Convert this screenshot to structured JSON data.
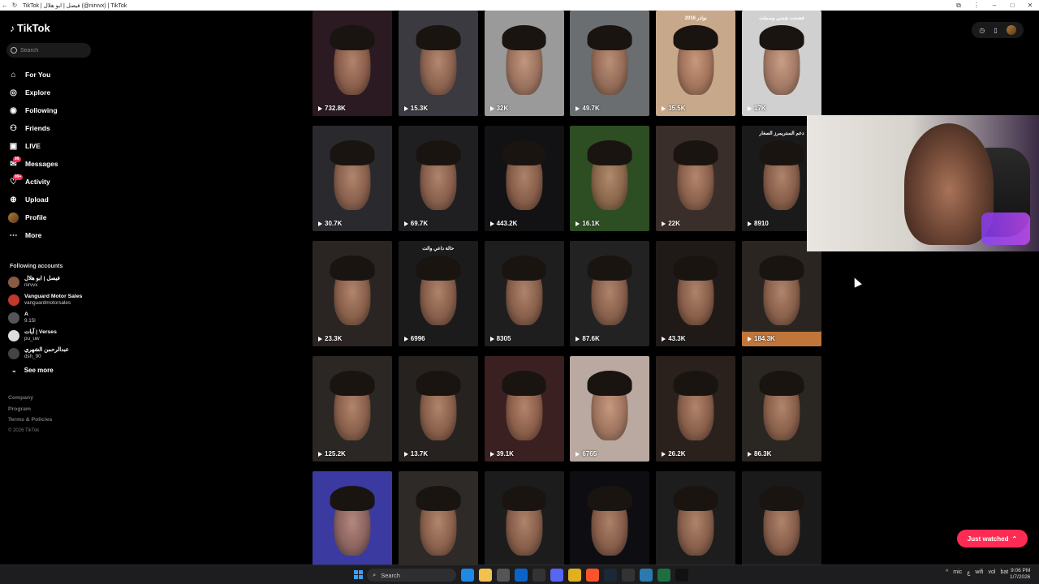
{
  "browser": {
    "title": "TikTok | فيصل | ابو هلال (@nirvvx) | TikTok",
    "back_icon": "back-arrow-icon",
    "reload_icon": "reload-icon",
    "controls": [
      "minimize",
      "maximize",
      "close"
    ]
  },
  "sidebar": {
    "logo": "TikTok",
    "search_placeholder": "Search",
    "menu": [
      {
        "label": "For You",
        "icon": "home-icon"
      },
      {
        "label": "Explore",
        "icon": "compass-icon"
      },
      {
        "label": "Following",
        "icon": "following-icon"
      },
      {
        "label": "Friends",
        "icon": "friends-icon"
      },
      {
        "label": "LIVE",
        "icon": "live-icon"
      },
      {
        "label": "Messages",
        "icon": "messages-icon",
        "badge": "99"
      },
      {
        "label": "Activity",
        "icon": "activity-icon",
        "badge": "99+"
      },
      {
        "label": "Upload",
        "icon": "upload-icon"
      },
      {
        "label": "Profile",
        "icon": "profile-avatar"
      },
      {
        "label": "More",
        "icon": "more-icon"
      }
    ],
    "following_label": "Following accounts",
    "accounts": [
      {
        "name": "فيصل | ابو هلال",
        "handle": "nirvvx",
        "color": "#8a5a44"
      },
      {
        "name": "Vanguard Motor Sales",
        "handle": "vanguardmotorsales",
        "color": "#c0392b"
      },
      {
        "name": "A",
        "handle": "9.15l",
        "color": "#555555"
      },
      {
        "name": "آيات | Verses",
        "handle": "pu_uw",
        "color": "#dddddd"
      },
      {
        "name": "عبدالرحمن الشهري",
        "handle": "dsh_90",
        "color": "#444444"
      }
    ],
    "see_more": "See more",
    "footer": [
      "Company",
      "Program",
      "Terms & Policies"
    ],
    "copyright": "© 2026 TikTok"
  },
  "videos": [
    {
      "views": "732.8K",
      "bg": "#2b1a22"
    },
    {
      "views": "15.3K",
      "bg": "#3a3a40"
    },
    {
      "views": "32K",
      "bg": "#9a9a9a"
    },
    {
      "views": "49.7K",
      "bg": "#6a6e70"
    },
    {
      "views": "35.5K",
      "bg": "#c8a88a",
      "caption": "نوادر 2016"
    },
    {
      "views": "17K",
      "bg": "#d0d0d0",
      "caption": "فضحت نفسي وسملت"
    },
    {
      "views": "30.7K",
      "bg": "#2a2a2e"
    },
    {
      "views": "69.7K",
      "bg": "#1f1f22"
    },
    {
      "views": "443.2K",
      "bg": "#121214"
    },
    {
      "views": "16.1K",
      "bg": "#2d4d22"
    },
    {
      "views": "22K",
      "bg": "#3a2e2a"
    },
    {
      "views": "8910",
      "bg": "#1a1a1a",
      "caption": "دعم الستريمرز الصغار"
    },
    {
      "views": "23.3K",
      "bg": "#2a2523"
    },
    {
      "views": "6996",
      "bg": "#1b1b1b",
      "caption": "حالة داعي والت"
    },
    {
      "views": "8305",
      "bg": "#1e1e1e"
    },
    {
      "views": "87.6K",
      "bg": "#222222"
    },
    {
      "views": "43.3K",
      "bg": "#1f1a18"
    },
    {
      "views": "184.3K",
      "bg": "#2b2522",
      "highlight": true
    },
    {
      "views": "125.2K",
      "bg": "#2a2724"
    },
    {
      "views": "13.7K",
      "bg": "#262220"
    },
    {
      "views": "39.1K",
      "bg": "#3a2020"
    },
    {
      "views": "6765",
      "bg": "#b9a9a0"
    },
    {
      "views": "26.2K",
      "bg": "#2a211c"
    },
    {
      "views": "86.3K",
      "bg": "#2a2622"
    },
    {
      "views": "",
      "bg": "#3a3aa0"
    },
    {
      "views": "",
      "bg": "#2e2a28"
    },
    {
      "views": "",
      "bg": "#1c1c1c"
    },
    {
      "views": "",
      "bg": "#0e0e12"
    },
    {
      "views": "",
      "bg": "#1d1d1d"
    },
    {
      "views": "",
      "bg": "#1a1a1a"
    }
  ],
  "topbar_pill": {
    "icons": [
      "clock-icon",
      "phone-icon"
    ]
  },
  "just_watched": "Just watched",
  "taskbar": {
    "search": "Search",
    "apps": [
      {
        "icon": "edge-icon",
        "color": "#1e88e5"
      },
      {
        "icon": "folder-icon",
        "color": "#f2c14e"
      },
      {
        "icon": "store-icon",
        "color": "#555555"
      },
      {
        "icon": "outlook-icon",
        "color": "#0a64c8"
      },
      {
        "icon": "steam-icon",
        "color": "#333333"
      },
      {
        "icon": "discord-icon",
        "color": "#5865f2"
      },
      {
        "icon": "chrome-icon",
        "color": "#e0b020"
      },
      {
        "icon": "brave-icon",
        "color": "#fb542b"
      },
      {
        "icon": "steam2-icon",
        "color": "#1b2838"
      },
      {
        "icon": "obs-icon",
        "color": "#333333"
      },
      {
        "icon": "network-icon",
        "color": "#2a7ab0"
      },
      {
        "icon": "excel-icon",
        "color": "#1d6f42"
      },
      {
        "icon": "tiktok-icon",
        "color": "#111111"
      }
    ],
    "tray": [
      "^",
      "mic",
      "ع",
      "wifi",
      "vol",
      "bat"
    ],
    "time": "9:06 PM",
    "date": "1/7/2026"
  }
}
